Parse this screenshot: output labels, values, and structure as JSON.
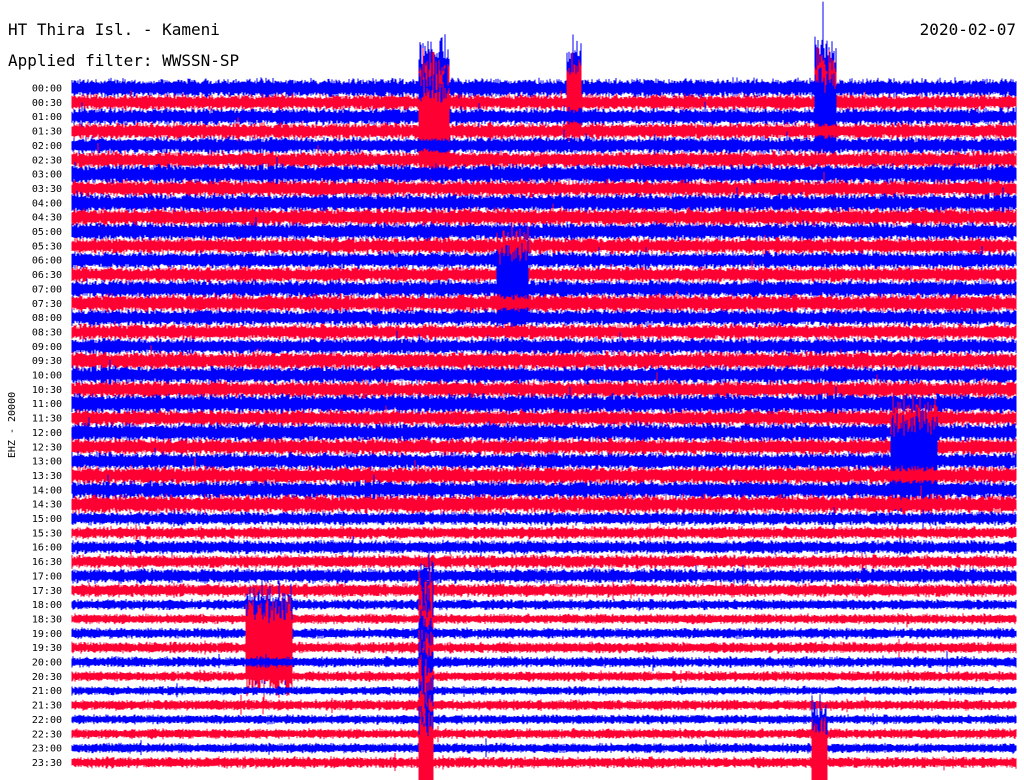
{
  "header": {
    "station": "HT Thira Isl. - Kameni",
    "date": "2020-02-07",
    "filter": "Applied filter: WWSSN-SP"
  },
  "chart_data": {
    "type": "line",
    "title": "HT Thira Isl. - Kameni",
    "subtitle": "Applied filter: WWSSN-SP",
    "ylabel": "EHZ - 20000",
    "row_labels": [
      "00:00",
      "00:30",
      "01:00",
      "01:30",
      "02:00",
      "02:30",
      "03:00",
      "03:30",
      "04:00",
      "04:30",
      "05:00",
      "05:30",
      "06:00",
      "06:30",
      "07:00",
      "07:30",
      "08:00",
      "08:30",
      "09:00",
      "09:30",
      "10:00",
      "10:30",
      "11:00",
      "11:30",
      "12:00",
      "12:30",
      "13:00",
      "13:30",
      "14:00",
      "14:30",
      "15:00",
      "15:30",
      "16:00",
      "16:30",
      "17:00",
      "17:30",
      "18:00",
      "18:30",
      "19:00",
      "19:30",
      "20:00",
      "20:30",
      "21:00",
      "21:30",
      "22:00",
      "22:30",
      "23:00",
      "23:30"
    ],
    "row_colors": [
      "#0000ff",
      "#ff0033"
    ],
    "minutes_per_row": 30,
    "events": [
      {
        "row_start": 0,
        "row_end": 3,
        "minute_start": 11,
        "minute_end": 12,
        "label": "large burst"
      },
      {
        "row_start": 0,
        "row_end": 1,
        "minute_start": 15.7,
        "minute_end": 16.2,
        "label": "burst"
      },
      {
        "row_start": 0,
        "row_end": 2,
        "minute_start": 23.6,
        "minute_end": 24.3,
        "label": "burst"
      },
      {
        "row_start": 13,
        "row_end": 14,
        "minute_start": 13.5,
        "minute_end": 14.5,
        "label": "event"
      },
      {
        "row_start": 25,
        "row_end": 26,
        "minute_start": 26,
        "minute_end": 27.5,
        "label": "event"
      },
      {
        "row_start": 38,
        "row_end": 39,
        "minute_start": 5.5,
        "minute_end": 7,
        "label": "event"
      },
      {
        "row_start": 36,
        "row_end": 47,
        "minute_start": 11,
        "minute_end": 11.5,
        "label": "disturbance"
      },
      {
        "row_start": 46,
        "row_end": 47,
        "minute_start": 23.5,
        "minute_end": 24,
        "label": "spike"
      }
    ]
  }
}
